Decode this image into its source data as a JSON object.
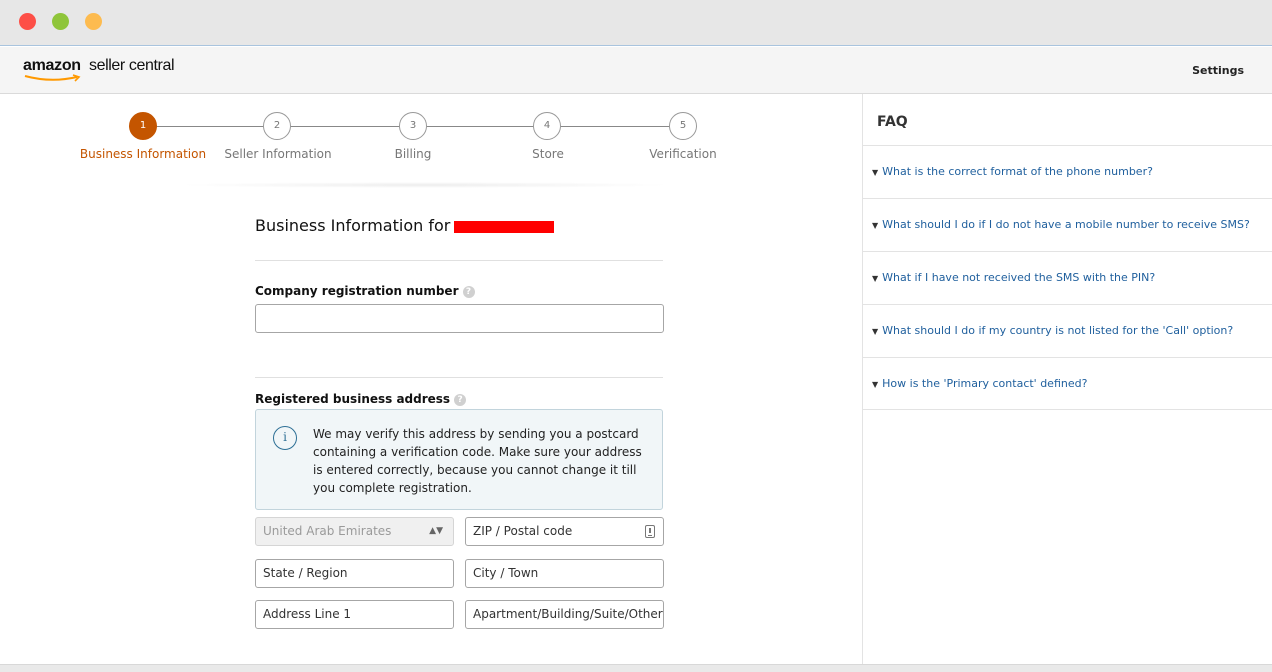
{
  "app": {
    "logo_brand": "amazon",
    "logo_product": "seller central",
    "settings_label": "Settings"
  },
  "stepper": {
    "steps": [
      {
        "number": "1",
        "label": "Business Information",
        "state": "active"
      },
      {
        "number": "2",
        "label": "Seller Information",
        "state": "pending"
      },
      {
        "number": "3",
        "label": "Billing",
        "state": "pending"
      },
      {
        "number": "4",
        "label": "Store",
        "state": "pending"
      },
      {
        "number": "5",
        "label": "Verification",
        "state": "pending"
      }
    ],
    "active_color": "#c45500"
  },
  "form": {
    "section_title": "Business Information for",
    "company_reg": {
      "label": "Company registration number",
      "value": ""
    },
    "address": {
      "label": "Registered business address",
      "info_text": "We may verify this address by sending you a postcard containing a verification code. Make sure your address is entered correctly, because you cannot change it till you complete registration.",
      "country_value": "United Arab Emirates",
      "zip_placeholder": "ZIP / Postal code",
      "state_placeholder": "State / Region",
      "city_placeholder": "City / Town",
      "line1_placeholder": "Address Line 1",
      "line2_placeholder": "Apartment/Building/Suite/Other"
    }
  },
  "faq": {
    "title": "FAQ",
    "items": [
      "What is the correct format of the phone number?",
      "What should I do if I do not have a mobile number to receive SMS?",
      "What if I have not received the SMS with the PIN?",
      "What should I do if my country is not listed for the 'Call' option?",
      "How is the 'Primary contact' defined?"
    ]
  },
  "colors": {
    "link": "#1f5f9d",
    "info_border": "#2d6f95",
    "redaction": "#ff0000"
  }
}
